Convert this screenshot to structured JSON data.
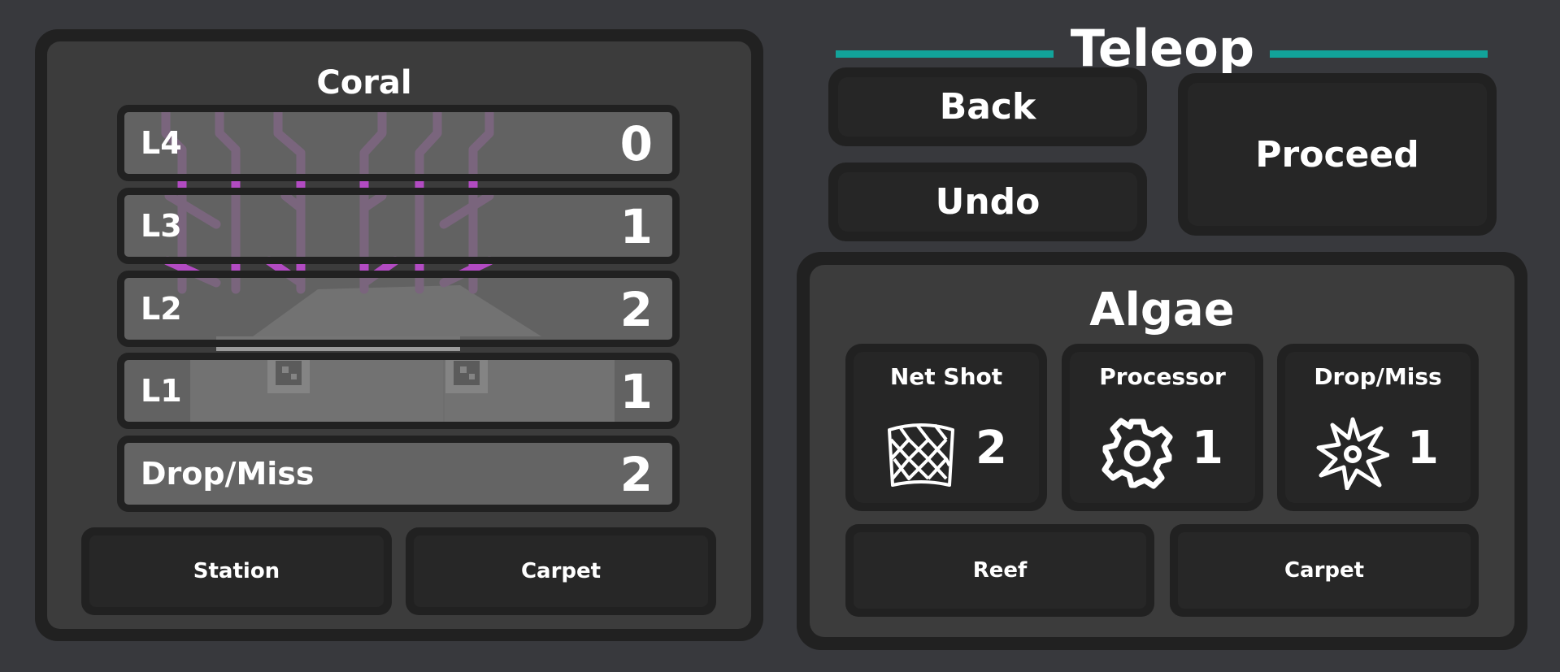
{
  "coral": {
    "title": "Coral",
    "levels": [
      {
        "label": "L4",
        "count": "0"
      },
      {
        "label": "L3",
        "count": "1"
      },
      {
        "label": "L2",
        "count": "2"
      },
      {
        "label": "L1",
        "count": "1"
      }
    ],
    "drop_miss": {
      "label": "Drop/Miss",
      "count": "2"
    },
    "station_label": "Station",
    "carpet_label": "Carpet"
  },
  "header": {
    "title": "Teleop",
    "accent_color": "#12a39a"
  },
  "actions": {
    "back_label": "Back",
    "undo_label": "Undo",
    "proceed_label": "Proceed"
  },
  "algae": {
    "title": "Algae",
    "cards": [
      {
        "label": "Net Shot",
        "count": "2",
        "icon": "net-icon"
      },
      {
        "label": "Processor",
        "count": "1",
        "icon": "gear-icon"
      },
      {
        "label": "Drop/Miss",
        "count": "1",
        "icon": "burst-icon"
      }
    ],
    "reef_label": "Reef",
    "carpet_label": "Carpet"
  }
}
